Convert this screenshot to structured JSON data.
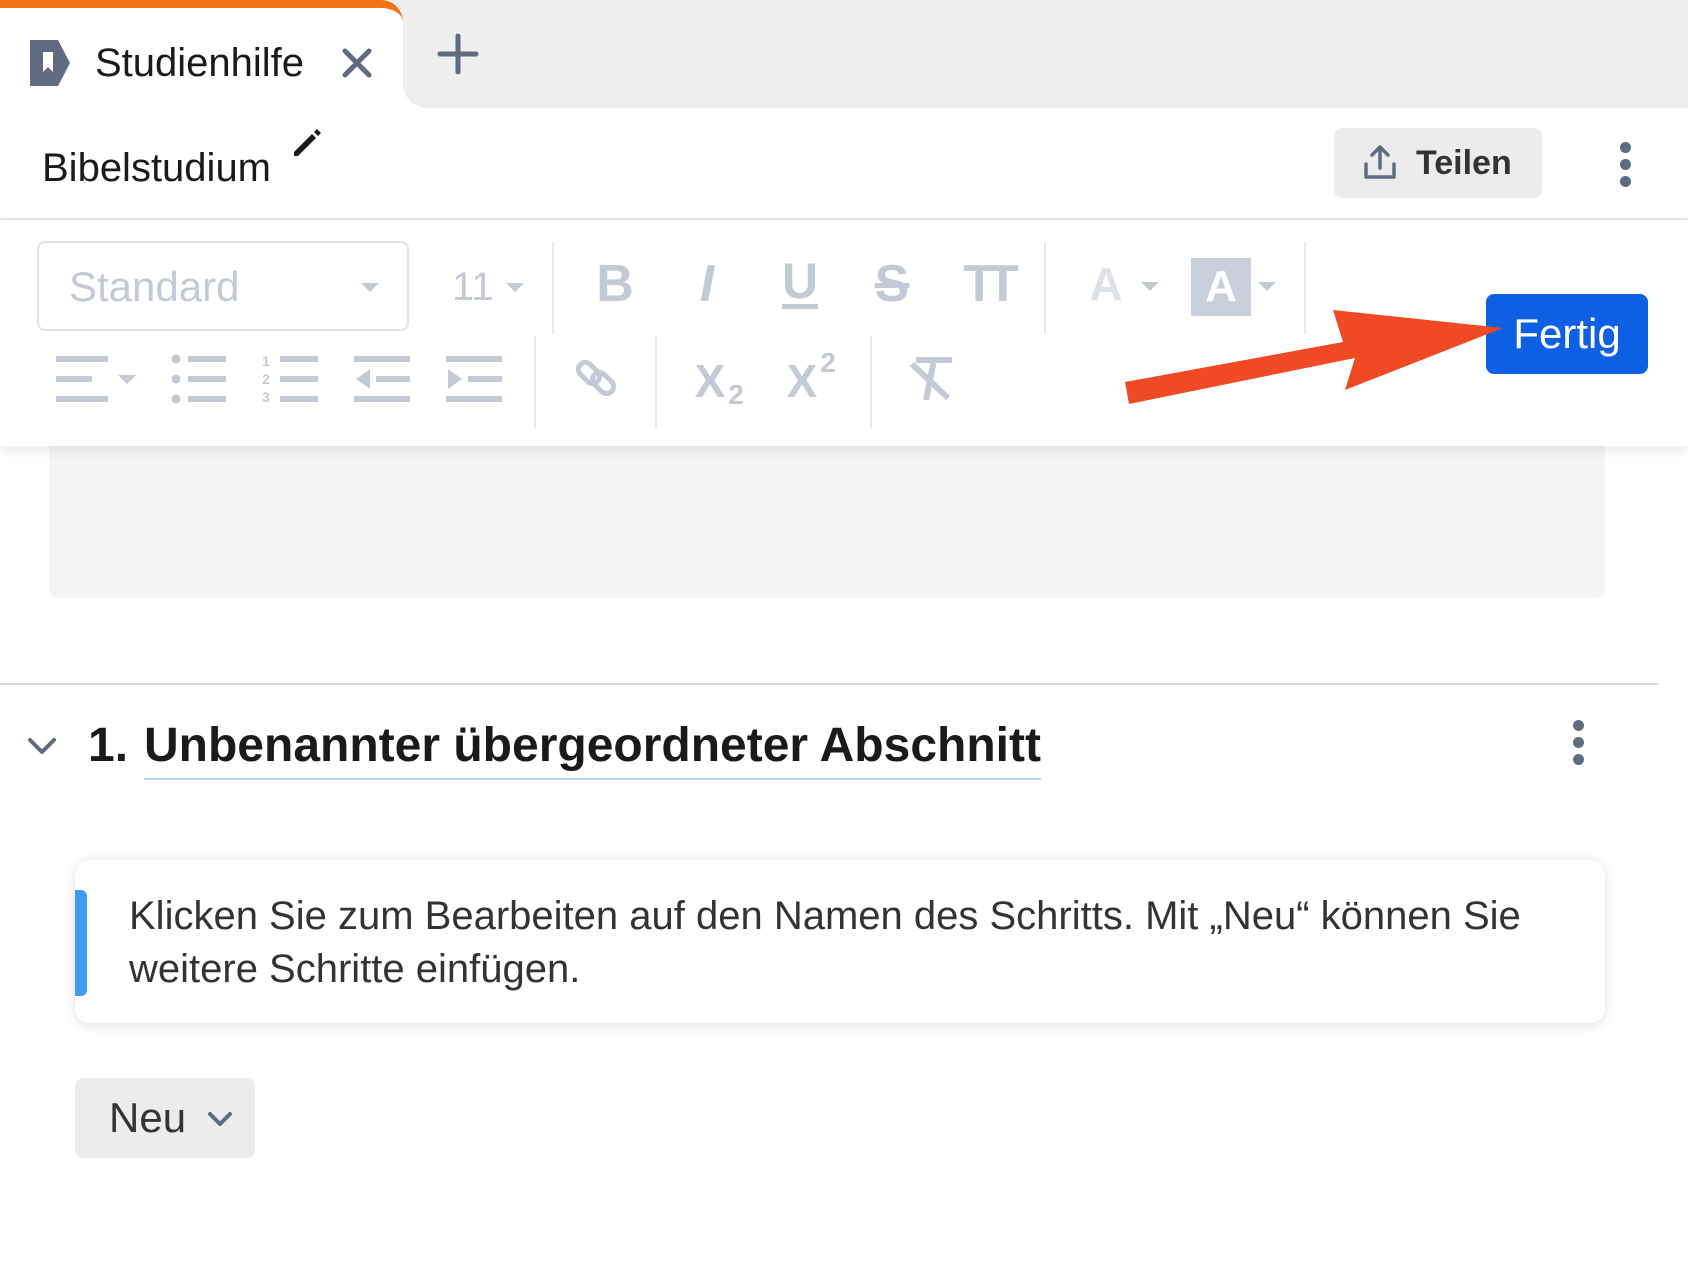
{
  "tab": {
    "title": "Studienhilfe",
    "accent_color": "#f47216",
    "icon": "bookmark-icon"
  },
  "header": {
    "title": "Bibelstudium",
    "share_label": "Teilen"
  },
  "toolbar": {
    "style_value": "Standard",
    "font_size": "11",
    "bold": "B",
    "italic": "I",
    "underline": "U",
    "strike": "S",
    "text_size": "TT",
    "font_color": "A",
    "highlight": "A",
    "subscript": "X",
    "subscript_index": "2",
    "superscript": "X",
    "superscript_index": "2",
    "done_label": "Fertig",
    "done_color": "#0d5fe3"
  },
  "annotation": {
    "arrow_color": "#f04a24"
  },
  "section": {
    "number": "1.",
    "title": "Unbenannter übergeordneter Abschnitt",
    "hint": "Klicken Sie zum Bearbeiten auf den Namen des Schritts. Mit „Neu“ können Sie weitere Schritte einfügen.",
    "new_label": "Neu"
  }
}
